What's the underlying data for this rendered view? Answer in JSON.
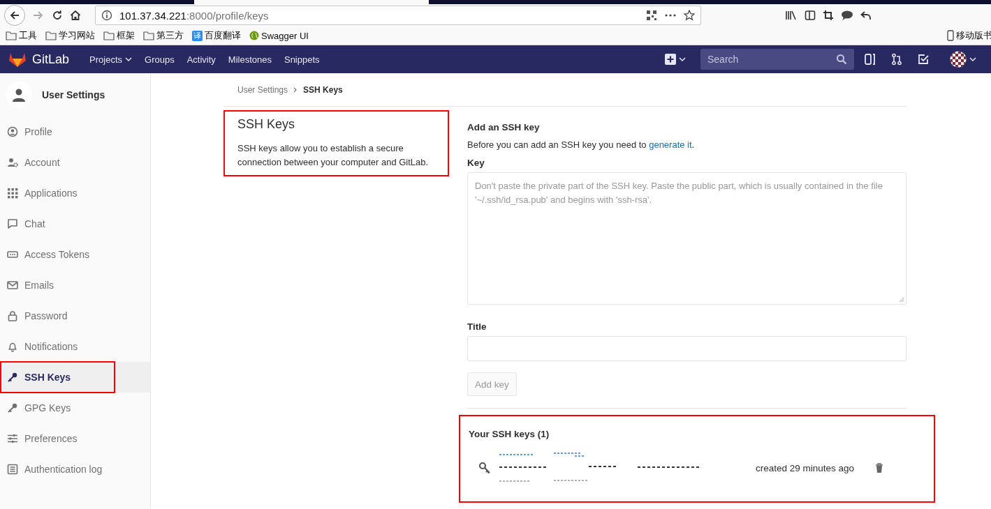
{
  "browser": {
    "url_host": "101.37.34.221",
    "url_rest": ":8000/profile/keys",
    "bookmarks": [
      {
        "kind": "folder",
        "label": "工具"
      },
      {
        "kind": "folder",
        "label": "学习网站"
      },
      {
        "kind": "folder",
        "label": "框架"
      },
      {
        "kind": "folder",
        "label": "第三方"
      },
      {
        "kind": "translate",
        "label": "百度翻译",
        "icon_text": "译"
      },
      {
        "kind": "swagger",
        "label": "Swagger UI"
      }
    ],
    "mobile_bookmarks": "移动版书"
  },
  "nav": {
    "brand": "GitLab",
    "links": [
      {
        "label": "Projects",
        "dropdown": true
      },
      {
        "label": "Groups",
        "dropdown": false
      },
      {
        "label": "Activity",
        "dropdown": false
      },
      {
        "label": "Milestones",
        "dropdown": false
      },
      {
        "label": "Snippets",
        "dropdown": false
      }
    ],
    "search_placeholder": "Search"
  },
  "sidebar": {
    "title": "User Settings",
    "items": [
      {
        "label": "Profile",
        "kind": "profile",
        "selected": false,
        "highlighted": false
      },
      {
        "label": "Account",
        "kind": "account",
        "selected": false,
        "highlighted": false
      },
      {
        "label": "Applications",
        "kind": "applications",
        "selected": false,
        "highlighted": false
      },
      {
        "label": "Chat",
        "kind": "chat",
        "selected": false,
        "highlighted": false
      },
      {
        "label": "Access Tokens",
        "kind": "tokens",
        "selected": false,
        "highlighted": false
      },
      {
        "label": "Emails",
        "kind": "emails",
        "selected": false,
        "highlighted": false
      },
      {
        "label": "Password",
        "kind": "password",
        "selected": false,
        "highlighted": false
      },
      {
        "label": "Notifications",
        "kind": "notifications",
        "selected": false,
        "highlighted": false
      },
      {
        "label": "SSH Keys",
        "kind": "key",
        "selected": true,
        "highlighted": true
      },
      {
        "label": "GPG Keys",
        "kind": "key",
        "selected": false,
        "highlighted": false
      },
      {
        "label": "Preferences",
        "kind": "preferences",
        "selected": false,
        "highlighted": false
      },
      {
        "label": "Authentication log",
        "kind": "log",
        "selected": false,
        "highlighted": false
      }
    ]
  },
  "breadcrumb": [
    "User Settings",
    "SSH Keys"
  ],
  "intro": {
    "title": "SSH Keys",
    "text": "SSH keys allow you to establish a secure connection between your computer and GitLab.",
    "highlighted": true
  },
  "form": {
    "heading": "Add an SSH key",
    "help": "Before you can add an SSH key you need to",
    "help_link": "generate it",
    "help_end": ".",
    "key_label": "Key",
    "key_placeholder": "Don't paste the private part of the SSH key. Paste the public part, which is usually contained in the file '~/.ssh/id_rsa.pub' and begins with 'ssh-rsa'.",
    "title_label": "Title",
    "button": "Add key",
    "button_disabled": true
  },
  "keys": {
    "heading": "Your SSH keys (1)",
    "highlighted": true,
    "items": [
      {
        "created": "created 29 minutes ago"
      }
    ]
  }
}
